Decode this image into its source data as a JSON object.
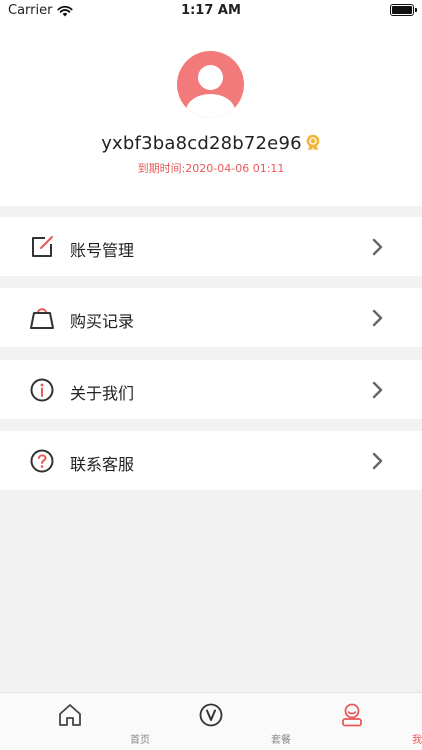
{
  "status_bar": {
    "carrier": "Carrier",
    "time": "1:17 AM"
  },
  "profile": {
    "username": "yxbf3ba8cd28b72e96",
    "expiry": "到期时间:2020-04-06 01:11"
  },
  "menu": [
    {
      "label": "账号管理",
      "icon": "edit-icon"
    },
    {
      "label": "购买记录",
      "icon": "shopping-bag-icon"
    },
    {
      "label": "关于我们",
      "icon": "info-icon"
    },
    {
      "label": "联系客服",
      "icon": "help-icon"
    }
  ],
  "tabs": [
    {
      "label": "首页",
      "icon": "home-icon"
    },
    {
      "label": "套餐",
      "icon": "vip-icon"
    },
    {
      "label": "我的",
      "icon": "profile-icon",
      "active": true
    }
  ],
  "colors": {
    "accent": "#e85a5a",
    "avatar": "#f27a7a",
    "badge": "#f2b53a"
  }
}
